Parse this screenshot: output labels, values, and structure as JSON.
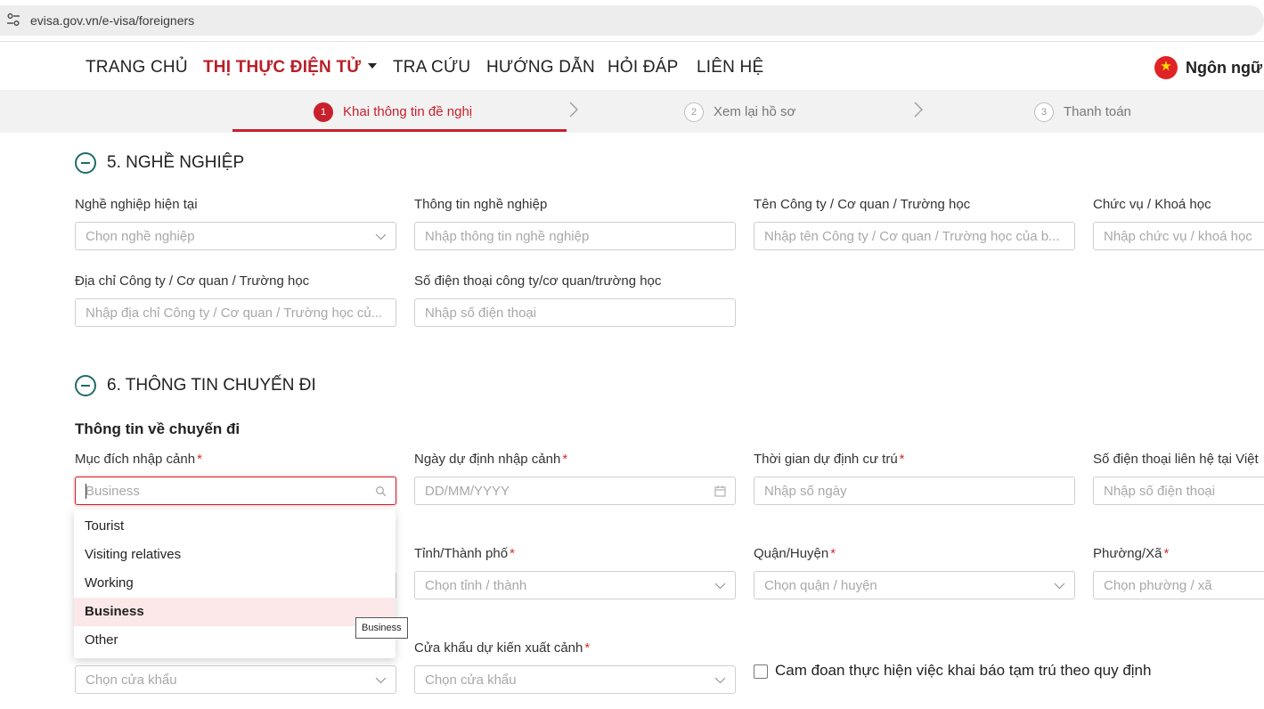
{
  "browser": {
    "url": "evisa.gov.vn/e-visa/foreigners"
  },
  "nav": {
    "items": [
      "TRANG CHỦ",
      "THỊ THỰC ĐIỆN TỬ",
      "TRA CỨU",
      "HƯỚNG DẪN",
      "HỎI ĐÁP",
      "LIÊN HỆ"
    ],
    "language_label": "Ngôn ngữ",
    "accent_color": "#b8202a"
  },
  "stepper": {
    "steps": [
      {
        "num": "1",
        "label": "Khai thông tin đề nghị"
      },
      {
        "num": "2",
        "label": "Xem lại hồ sơ"
      },
      {
        "num": "3",
        "label": "Thanh toán"
      }
    ]
  },
  "section5": {
    "title": "5. NGHỀ NGHIỆP",
    "fields": [
      {
        "label": "Nghề nghiệp hiện tại",
        "placeholder": "Chọn nghề nghiệp"
      },
      {
        "label": "Thông tin nghề nghiệp",
        "placeholder": "Nhập thông tin nghề nghiệp"
      },
      {
        "label": "Tên Công ty / Cơ quan / Trường học",
        "placeholder": "Nhập tên Công ty / Cơ quan / Trường học của b..."
      },
      {
        "label": "Chức vụ / Khoá học",
        "placeholder": "Nhập chức vụ / khoá học"
      },
      {
        "label": "Địa chỉ Công ty / Cơ quan / Trường học",
        "placeholder": "Nhập địa chỉ Công ty / Cơ quan / Trường học củ..."
      },
      {
        "label": "Số điện thoại công ty/cơ quan/trường học",
        "placeholder": "Nhập số điện thoại"
      }
    ]
  },
  "section6": {
    "title": "6. THÔNG TIN CHUYẾN ĐI",
    "subtitle": "Thông tin về chuyến đi",
    "required_mark": "*",
    "fields": [
      {
        "label": "Mục đích nhập cảnh",
        "placeholder": "Business"
      },
      {
        "label": "Ngày dự định nhập cảnh",
        "placeholder": "DD/MM/YYYY"
      },
      {
        "label": "Thời gian dự định cư trú",
        "placeholder": "Nhập số ngày"
      },
      {
        "label": "Số điện thoại liên hệ tại Việt",
        "placeholder": "Nhập số điện thoại"
      },
      {
        "label": "Tỉnh/Thành phố",
        "placeholder": "Chọn tỉnh / thành"
      },
      {
        "label": "Quận/Huyện",
        "placeholder": "Chọn quận / huyện"
      },
      {
        "label": "Phường/Xã",
        "placeholder": "Chọn phường / xã"
      },
      {
        "label": "",
        "placeholder": "Chọn cửa khẩu"
      },
      {
        "label": "Cửa khẩu dự kiến xuất cảnh",
        "placeholder": "Chọn cửa khẩu"
      }
    ],
    "dropdown_options": [
      "Tourist",
      "Visiting relatives",
      "Working",
      "Business",
      "Other"
    ],
    "dropdown_selected": "Business",
    "tooltip": "Business",
    "checkbox_label": "Cam đoan thực hiện việc khai báo tạm trú theo quy định"
  }
}
